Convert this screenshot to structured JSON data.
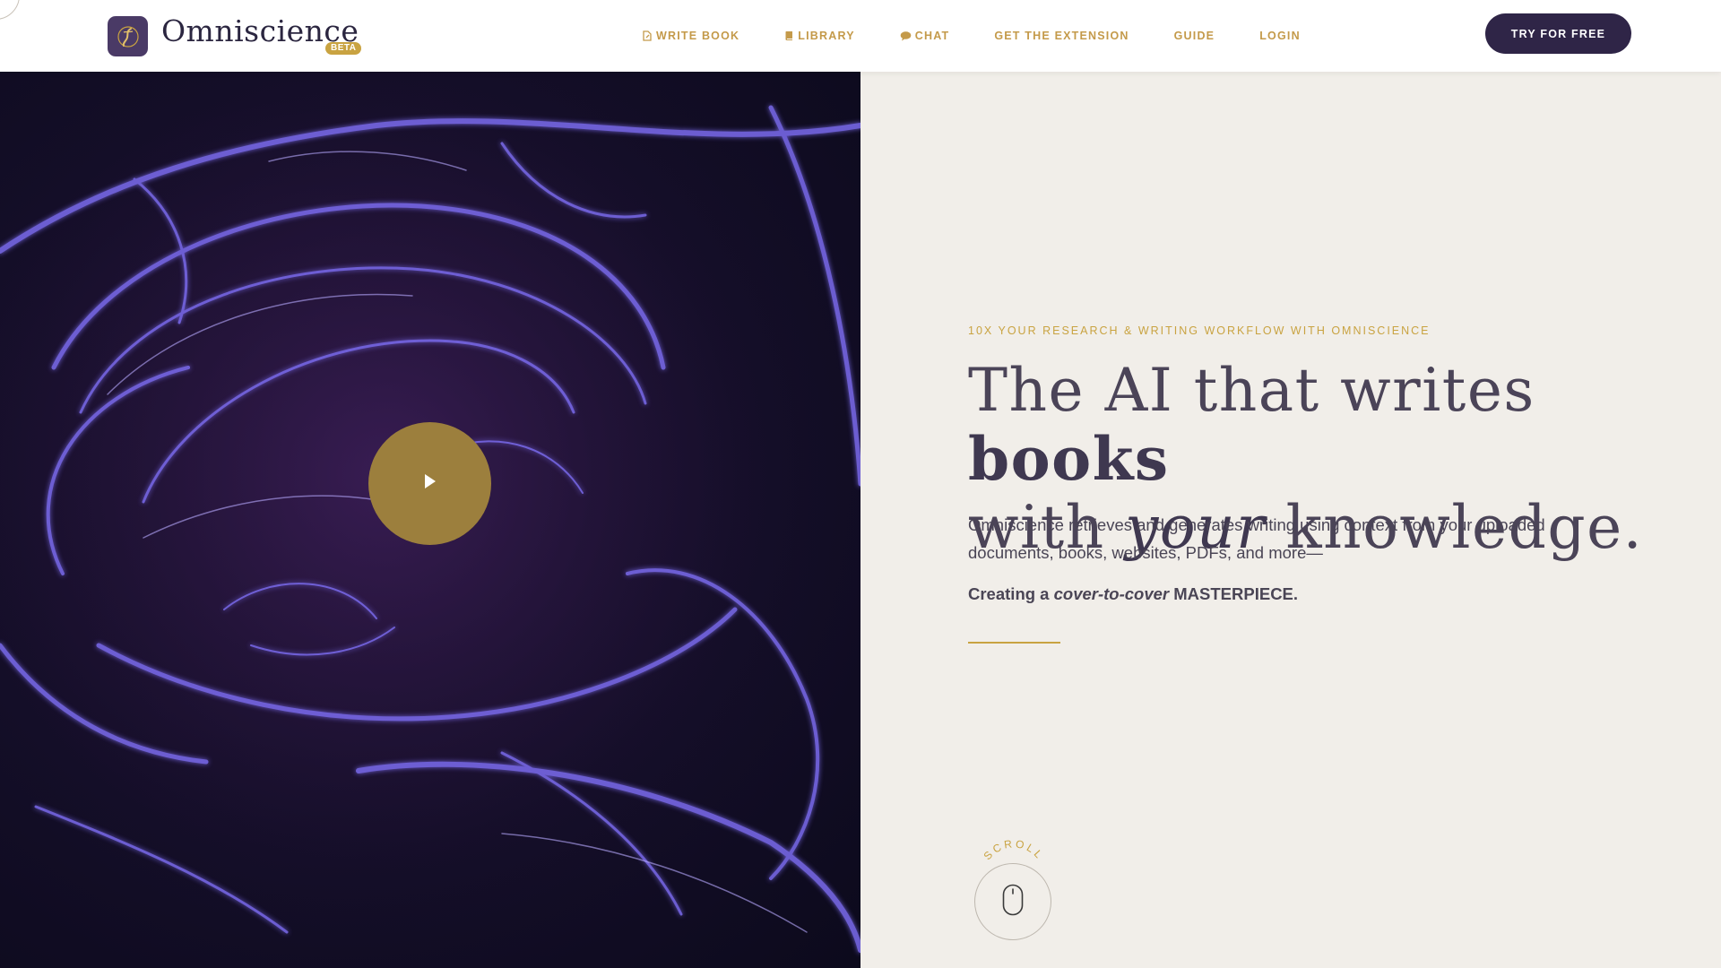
{
  "brand": {
    "name": "Omniscience",
    "badge": "BETA",
    "logo_icon": "book-logo-icon",
    "colors": {
      "accent": "#c9a341",
      "dark": "#2f2547",
      "background": "#f1eee9"
    }
  },
  "nav": {
    "items": [
      {
        "label": "WRITE BOOK",
        "icon": "write-book-icon"
      },
      {
        "label": "LIBRARY",
        "icon": "library-icon"
      },
      {
        "label": "CHAT",
        "icon": "chat-icon"
      },
      {
        "label": "GET THE EXTENSION",
        "icon": ""
      },
      {
        "label": "GUIDE",
        "icon": ""
      },
      {
        "label": "LOGIN",
        "icon": ""
      }
    ],
    "cta_label": "TRY FOR FREE"
  },
  "hero": {
    "eyebrow": "10X YOUR RESEARCH & WRITING WORKFLOW WITH OMNISCIENCE",
    "headline": {
      "part1": "The AI that writes ",
      "bold_word": "books",
      "part2": "with ",
      "italic_word": "your",
      "part3": " knowledge."
    },
    "description": "Omniscience retrieves and generates writing using context from your uploaded documents, books, websites, PDFs, and more—",
    "tagline": {
      "prefix": "Creating a ",
      "italic": "cover-to-cover",
      "suffix": " MASTERPIECE."
    },
    "play_icon": "play-icon",
    "image_subject": "glowing-brain"
  },
  "scroll": {
    "label": "SCROLL",
    "icon": "mouse-icon"
  }
}
